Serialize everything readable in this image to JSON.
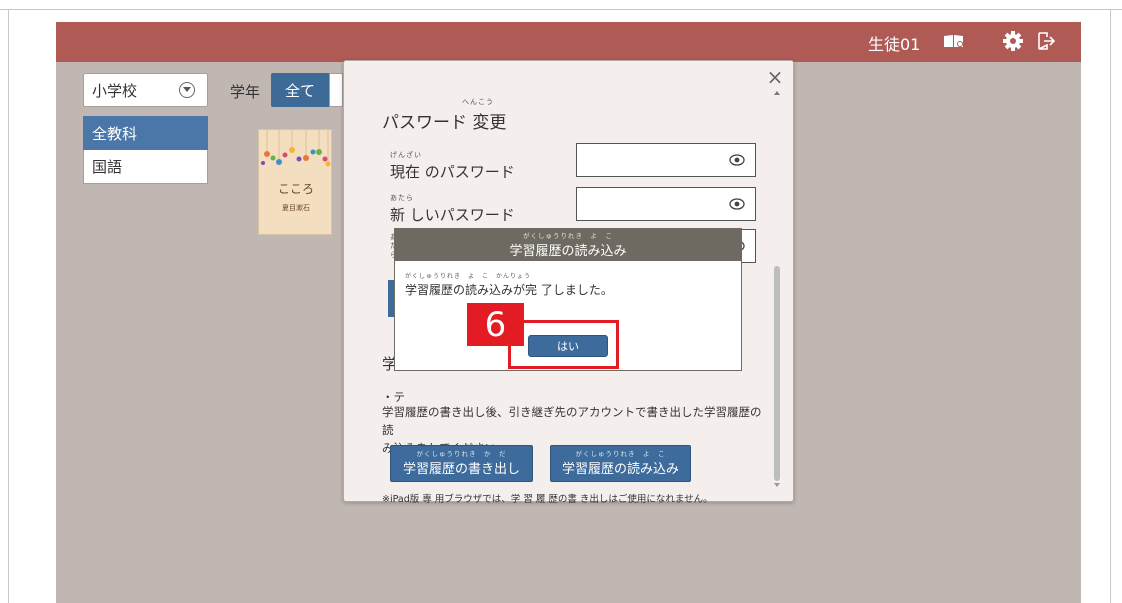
{
  "topbar": {
    "user_name": "生徒01",
    "icons": [
      "book-icon",
      "gear-icon",
      "logout-icon"
    ]
  },
  "filters": {
    "school_value": "小学校",
    "grade_label": "学年",
    "grade_selected": "全て",
    "subjects": [
      "全教科",
      "国語"
    ]
  },
  "book": {
    "title": "こころ",
    "author": "夏目漱石"
  },
  "settings_modal": {
    "close_symbol": "×",
    "password_section": {
      "title": "パスワード 変更",
      "title_ruby": "へんこう",
      "current_ruby": "げんざい",
      "current_label": "現在 のパスワード",
      "new_ruby": "あたら",
      "new_label": "新 しいパスワード",
      "confirm_ruby": "あたら"
    },
    "history_section": {
      "heading_partial": "学",
      "text_line1": "・テ",
      "text_line2": "学習履歴の書き出し後、引き継ぎ先のアカウントで書き出した学習履歴の 読",
      "text_line3": "み込みをしてください。",
      "export_ruby": "がくしゅうりれき　か　だ",
      "export_label": "学習履歴の書き出し",
      "import_ruby": "がくしゅうりれき　よ　こ",
      "import_label": "学習履歴の読み込み",
      "note": "※iPad版 専 用ブラウザでは、学 習 履 歴の書 き出しはご使用になれません。"
    }
  },
  "dialog": {
    "title_ruby": "がくしゅうりれき　よ　こ",
    "title": "学習履歴の読み込み",
    "message_ruby": "がくしゅうりれき　よ　こ　かんりょう",
    "message": "学習履歴の読み込みが完 了しました。",
    "yes_label": "はい"
  },
  "annotation": {
    "step_number": "6",
    "color": "#e31c23"
  },
  "colors": {
    "topbar": "#b05a55",
    "background": "#c0b6b2",
    "primary_button": "#3d6b9c"
  }
}
